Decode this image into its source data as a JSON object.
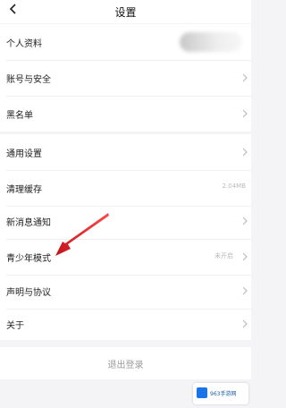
{
  "header": {
    "title": "设置",
    "back_icon": "chevron-left-icon"
  },
  "rows": [
    {
      "label": "个人资料",
      "value": "",
      "chevron": false
    },
    {
      "label": "账号与安全",
      "value": "",
      "chevron": true
    },
    {
      "label": "黑名单",
      "value": "",
      "chevron": true
    },
    {
      "label": "通用设置",
      "value": "",
      "chevron": true
    },
    {
      "label": "清理缓存",
      "value": "2.04MB",
      "chevron": false
    },
    {
      "label": "新消息通知",
      "value": "",
      "chevron": true
    },
    {
      "label": "青少年模式",
      "value": "未开启",
      "chevron": true
    },
    {
      "label": "声明与协议",
      "value": "",
      "chevron": true
    },
    {
      "label": "关于",
      "value": "",
      "chevron": true
    }
  ],
  "logout": {
    "label": "退出登录"
  },
  "watermark": {
    "text": "963手游网"
  },
  "colors": {
    "arrow": "#e0202a",
    "background": "#f4f4f6",
    "row": "#ffffff"
  }
}
